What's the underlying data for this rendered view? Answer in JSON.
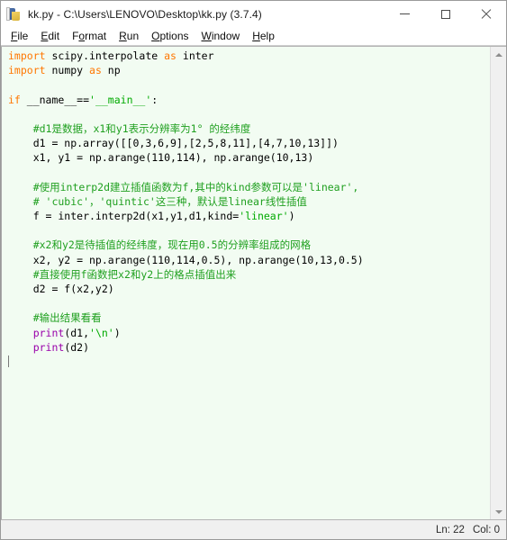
{
  "window": {
    "title": "kk.py - C:\\Users\\LENOVO\\Desktop\\kk.py (3.7.4)",
    "icon": "python-idle-icon",
    "controls": {
      "minimize": "minimize-button",
      "maximize": "maximize-button",
      "close": "close-button"
    }
  },
  "menubar": {
    "items": [
      {
        "label": "File",
        "accel": "F"
      },
      {
        "label": "Edit",
        "accel": "E"
      },
      {
        "label": "Format",
        "accel": "o"
      },
      {
        "label": "Run",
        "accel": "R"
      },
      {
        "label": "Options",
        "accel": "O"
      },
      {
        "label": "Window",
        "accel": "W"
      },
      {
        "label": "Help",
        "accel": "H"
      }
    ]
  },
  "editor": {
    "background_color": "#f2fcf2",
    "colors": {
      "keyword": "#ff7700",
      "string": "#00aa00",
      "comment": "#20a020",
      "builtin": "#9900aa",
      "definition": "#0000ff",
      "text": "#000000"
    },
    "lines": [
      {
        "n": 1,
        "tokens": [
          {
            "t": "kw",
            "v": "import"
          },
          {
            "t": "txt",
            "v": " scipy.interpolate "
          },
          {
            "t": "kw",
            "v": "as"
          },
          {
            "t": "txt",
            "v": " inter"
          }
        ]
      },
      {
        "n": 2,
        "tokens": [
          {
            "t": "kw",
            "v": "import"
          },
          {
            "t": "txt",
            "v": " numpy "
          },
          {
            "t": "kw",
            "v": "as"
          },
          {
            "t": "txt",
            "v": " np"
          }
        ]
      },
      {
        "n": 3,
        "tokens": []
      },
      {
        "n": 4,
        "tokens": [
          {
            "t": "kw",
            "v": "if"
          },
          {
            "t": "txt",
            "v": " __name__=="
          },
          {
            "t": "str",
            "v": "'__main__'"
          },
          {
            "t": "txt",
            "v": ":"
          }
        ]
      },
      {
        "n": 5,
        "tokens": []
      },
      {
        "n": 6,
        "tokens": [
          {
            "t": "cmt",
            "v": "    #d1是数据，x1和y1表示分辨率为1° 的经纬度"
          }
        ]
      },
      {
        "n": 7,
        "tokens": [
          {
            "t": "txt",
            "v": "    d1 = np.array([[0,3,6,9],[2,5,8,11],[4,7,10,13]])"
          }
        ]
      },
      {
        "n": 8,
        "tokens": [
          {
            "t": "txt",
            "v": "    x1, y1 = np.arange(110,114), np.arange(10,13)"
          }
        ]
      },
      {
        "n": 9,
        "tokens": []
      },
      {
        "n": 10,
        "tokens": [
          {
            "t": "cmt",
            "v": "    #使用interp2d建立插值函数为f,其中的kind参数可以是"
          },
          {
            "t": "cmt",
            "v": "'linear',"
          }
        ]
      },
      {
        "n": 11,
        "tokens": [
          {
            "t": "cmt",
            "v": "    # 'cubic'，'quintic'这三种，默认是linear线性插值"
          }
        ]
      },
      {
        "n": 12,
        "tokens": [
          {
            "t": "txt",
            "v": "    f = inter.interp2d(x1,y1,d1,kind="
          },
          {
            "t": "str",
            "v": "'linear'"
          },
          {
            "t": "txt",
            "v": ")"
          }
        ]
      },
      {
        "n": 13,
        "tokens": []
      },
      {
        "n": 14,
        "tokens": [
          {
            "t": "cmt",
            "v": "    #x2和y2是待插值的经纬度，现在用0.5的分辨率组成的网格"
          }
        ]
      },
      {
        "n": 15,
        "tokens": [
          {
            "t": "txt",
            "v": "    x2, y2 = np.arange(110,114,0.5), np.arange(10,13,0.5)"
          }
        ]
      },
      {
        "n": 16,
        "tokens": [
          {
            "t": "cmt",
            "v": "    #直接使用f函数把x2和y2上的格点插值出来"
          }
        ]
      },
      {
        "n": 17,
        "tokens": [
          {
            "t": "txt",
            "v": "    d2 = f(x2,y2)"
          }
        ]
      },
      {
        "n": 18,
        "tokens": []
      },
      {
        "n": 19,
        "tokens": [
          {
            "t": "cmt",
            "v": "    #输出结果看看"
          }
        ]
      },
      {
        "n": 20,
        "tokens": [
          {
            "t": "txt",
            "v": "    "
          },
          {
            "t": "bi",
            "v": "print"
          },
          {
            "t": "txt",
            "v": "(d1,"
          },
          {
            "t": "str",
            "v": "'\\n'"
          },
          {
            "t": "txt",
            "v": ")"
          }
        ]
      },
      {
        "n": 21,
        "tokens": [
          {
            "t": "txt",
            "v": "    "
          },
          {
            "t": "bi",
            "v": "print"
          },
          {
            "t": "txt",
            "v": "(d2)"
          }
        ]
      },
      {
        "n": 22,
        "tokens": [],
        "caret": true
      }
    ]
  },
  "scrollbar": {
    "up_arrow": "scroll-up-arrow",
    "down_arrow": "scroll-down-arrow"
  },
  "statusbar": {
    "line": "Ln: 22",
    "column": "Col: 0"
  }
}
